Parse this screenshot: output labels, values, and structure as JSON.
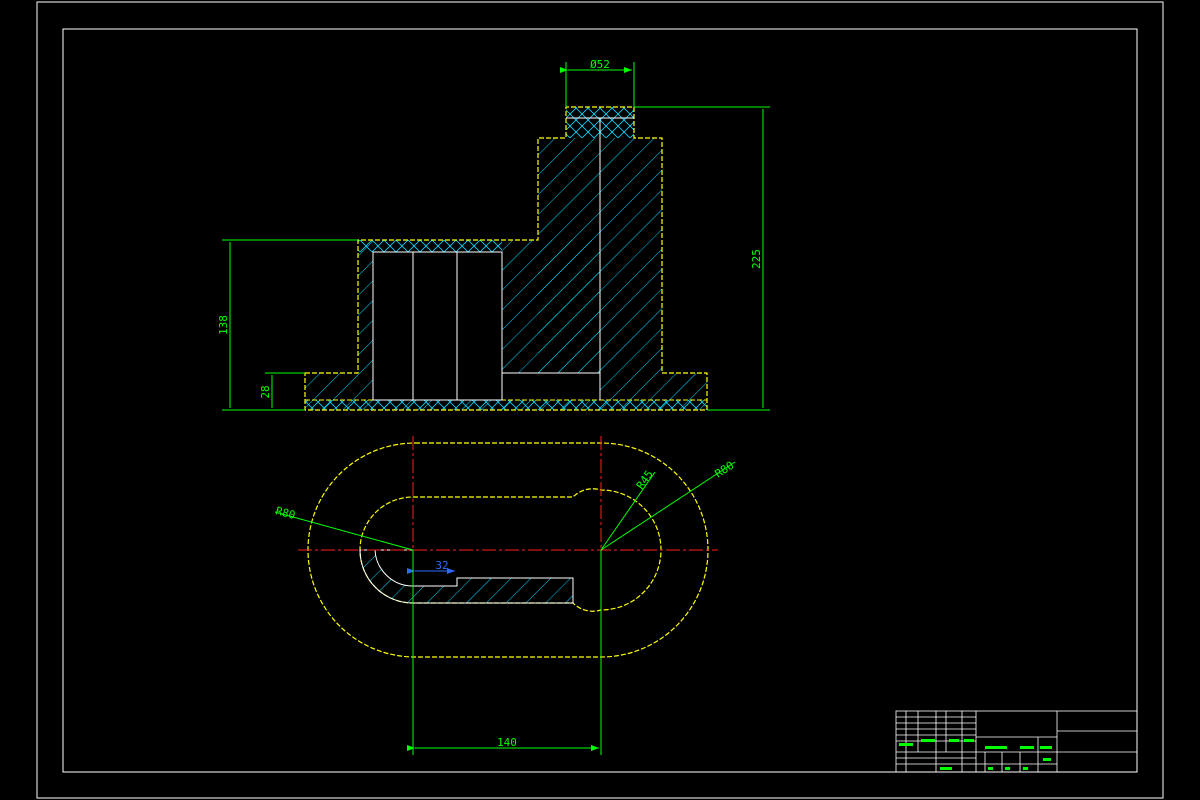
{
  "drawing": {
    "colors": {
      "background": "#000000",
      "border": "#ffffff",
      "outline": "#ffff00",
      "dimension": "#00ff00",
      "hatch": "#00d8ff",
      "centerline": "#ff2020",
      "highlight_dim": "#2f6bff"
    }
  },
  "dimensions": {
    "diameter_top": "Ø52",
    "total_height": "225",
    "body_height": "138",
    "base_height": "28",
    "radius_outer_left": "R80",
    "radius_inner": "R45",
    "radius_outer_right": "R80",
    "slot_offset": "32",
    "center_distance": "140"
  }
}
